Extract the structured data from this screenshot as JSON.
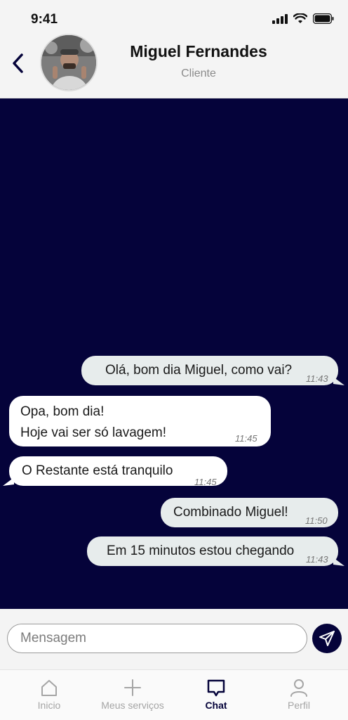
{
  "status_bar": {
    "time": "9:41"
  },
  "header": {
    "contact_name": "Miguel Fernandes",
    "contact_role": "Cliente"
  },
  "messages": [
    {
      "direction": "outgoing",
      "lines": [
        "Olá, bom dia Miguel, como vai?"
      ],
      "time": "11:43"
    },
    {
      "direction": "incoming",
      "lines": [
        "Opa, bom dia!",
        "Hoje vai ser só lavagem!"
      ],
      "time": "11:45"
    },
    {
      "direction": "incoming",
      "lines": [
        "O Restante está tranquilo"
      ],
      "time": "11:45"
    },
    {
      "direction": "outgoing",
      "lines": [
        "Combinado Miguel!"
      ],
      "time": "11:50"
    },
    {
      "direction": "outgoing",
      "lines": [
        "Em 15 minutos estou chegando"
      ],
      "time": "11:43"
    }
  ],
  "composer": {
    "placeholder": "Mensagem"
  },
  "nav": {
    "items": [
      {
        "label": "Inicio",
        "icon": "home-icon",
        "active": false
      },
      {
        "label": "Meus serviços",
        "icon": "plus-icon",
        "active": false
      },
      {
        "label": "Chat",
        "icon": "chat-icon",
        "active": true
      },
      {
        "label": "Perfil",
        "icon": "user-icon",
        "active": false
      }
    ]
  },
  "colors": {
    "chat_background": "#05033a",
    "outgoing_bubble": "#e7ecec",
    "incoming_bubble": "#ffffff",
    "accent": "#05033a"
  }
}
